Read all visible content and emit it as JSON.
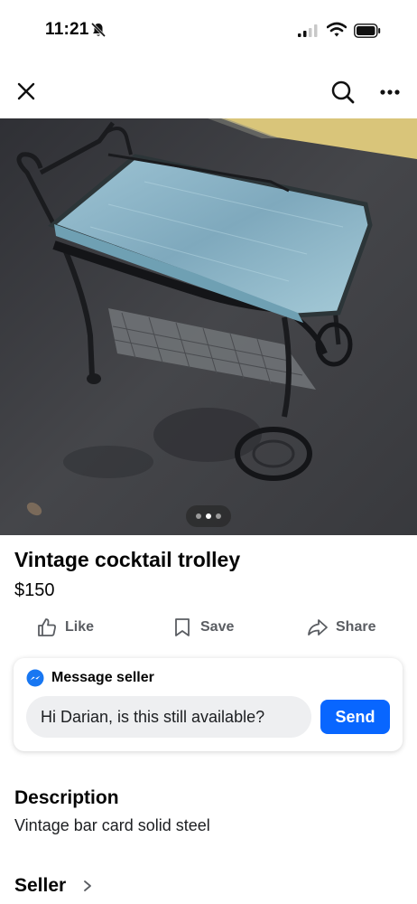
{
  "status_bar": {
    "time": "11:21",
    "icons": [
      "bell-slash-icon",
      "cellular-signal-icon",
      "wifi-icon",
      "battery-icon"
    ]
  },
  "nav": {
    "left_icon": "close-icon",
    "right_icons": [
      "search-icon",
      "more-icon"
    ]
  },
  "photo": {
    "description_icon": "listing-photo",
    "carousel": {
      "count": 3,
      "active_index": 1
    }
  },
  "listing": {
    "title": "Vintage cocktail trolley",
    "price": "$150"
  },
  "actions": {
    "like_label": "Like",
    "save_label": "Save",
    "share_label": "Share"
  },
  "message": {
    "heading": "Message seller",
    "input_value": "Hi Darian, is this still available?",
    "send_label": "Send"
  },
  "description": {
    "heading": "Description",
    "text": "Vintage bar card solid steel"
  },
  "seller": {
    "heading": "Seller"
  },
  "colors": {
    "accent_blue": "#0866ff",
    "messenger_blue": "#1877f2",
    "action_gray": "#5a5d62",
    "input_bg": "#eeeff1"
  }
}
